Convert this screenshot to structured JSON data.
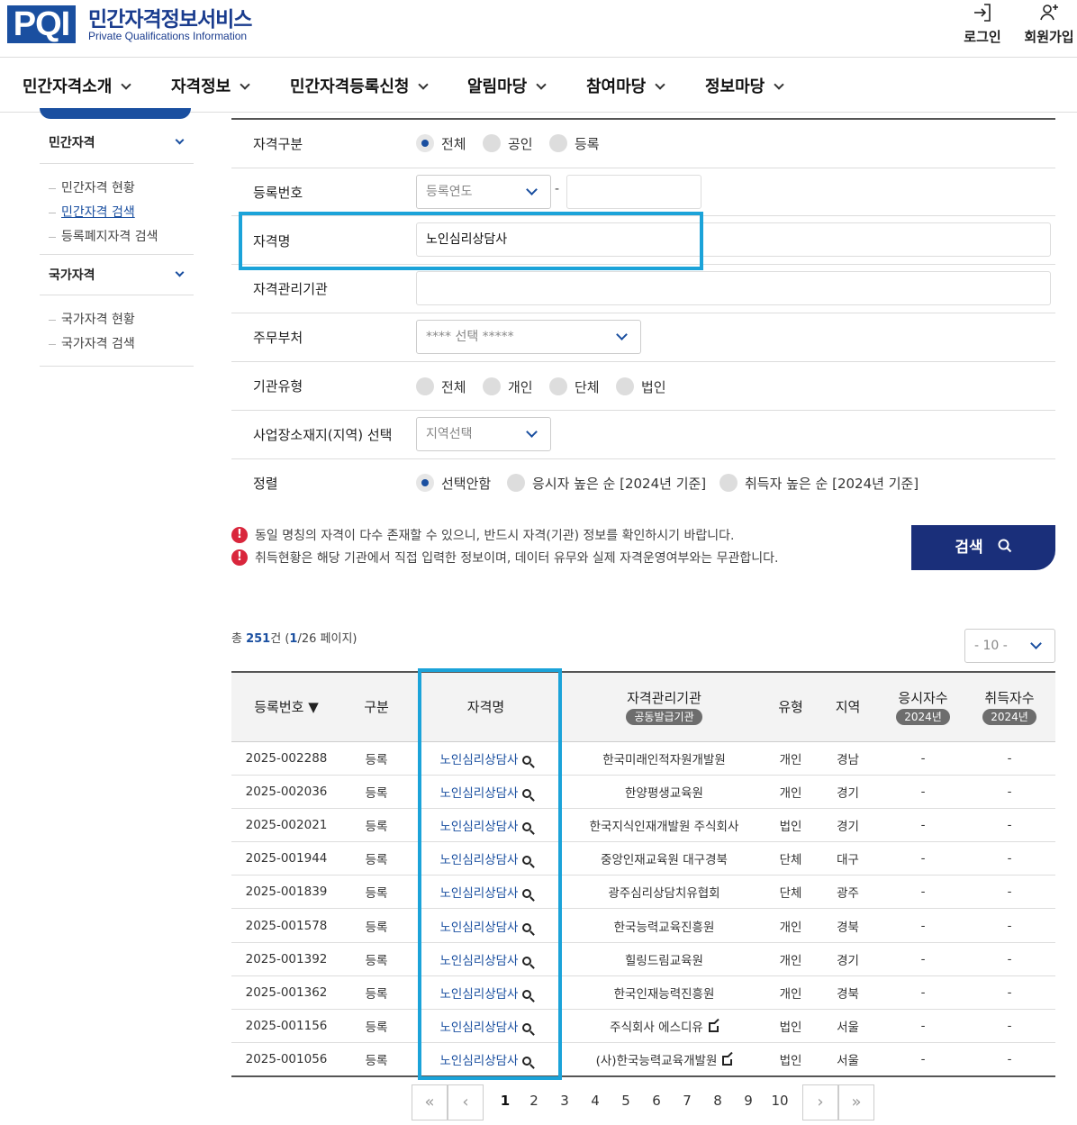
{
  "header": {
    "logo": "PQI",
    "title": "민간자격정보서비스",
    "subtitle": "Private Qualifications Information",
    "login_label": "로그인",
    "signup_label": "회원가입"
  },
  "nav": {
    "items": [
      "민간자격소개",
      "자격정보",
      "민간자격등록신청",
      "알림마당",
      "참여마당",
      "정보마당"
    ]
  },
  "sidebar": {
    "private_head": "민간자격",
    "private_links": [
      "민간자격 현황",
      "민간자격 검색",
      "등록폐지자격 검색"
    ],
    "national_head": "국가자격",
    "national_links": [
      "국가자격 현황",
      "국가자격 검색"
    ]
  },
  "form": {
    "category": {
      "label": "자격구분",
      "options": [
        "전체",
        "공인",
        "등록"
      ],
      "selected": "전체"
    },
    "reg_no": {
      "label": "등록번호",
      "year_placeholder": "등록연도",
      "sep": "-"
    },
    "name": {
      "label": "자격명",
      "value": "노인심리상담사"
    },
    "agency": {
      "label": "자격관리기관",
      "value": ""
    },
    "ministry": {
      "label": "주무부처",
      "placeholder": "**** 선택 *****"
    },
    "org_type": {
      "label": "기관유형",
      "options": [
        "전체",
        "개인",
        "단체",
        "법인"
      ]
    },
    "region": {
      "label": "사업장소재지(지역) 선택",
      "placeholder": "지역선택"
    },
    "sort": {
      "label": "정렬",
      "options": [
        "선택안함",
        "응시자 높은 순 [2024년 기준]",
        "취득자 높은 순 [2024년 기준]"
      ],
      "selected": "선택안함"
    }
  },
  "notices": [
    "동일 명칭의 자격이 다수 존재할 수 있으니, 반드시 자격(기관) 정보를 확인하시기 바랍니다.",
    "취득현황은 해당 기관에서 직접 입력한 정보이며, 데이터 유무와 실제 자격운영여부와는 무관합니다."
  ],
  "search_label": "검색",
  "results": {
    "prefix": "총 ",
    "total": "251",
    "unit": "건",
    "page_open": " (",
    "page": "1",
    "page_rest": "/26 페이지)",
    "per_page": "- 10 -"
  },
  "table": {
    "headers": {
      "reg_no": "등록번호 ▼",
      "category": "구분",
      "name": "자격명",
      "agency": "자격관리기관",
      "agency_pill": "공동발급기관",
      "type": "유형",
      "region": "지역",
      "applicants": "응시자수",
      "applicants_pill": "2024년",
      "acquirers": "취득자수",
      "acquirers_pill": "2024년"
    },
    "rows": [
      {
        "reg_no": "2025-002288",
        "category": "등록",
        "name": "노인심리상담사",
        "agency": "한국미래인적자원개발원",
        "ext": false,
        "type": "개인",
        "region": "경남",
        "applicants": "-",
        "acquirers": "-"
      },
      {
        "reg_no": "2025-002036",
        "category": "등록",
        "name": "노인심리상담사",
        "agency": "한양평생교육원",
        "ext": false,
        "type": "개인",
        "region": "경기",
        "applicants": "-",
        "acquirers": "-"
      },
      {
        "reg_no": "2025-002021",
        "category": "등록",
        "name": "노인심리상담사",
        "agency": "한국지식인재개발원 주식회사",
        "ext": false,
        "type": "법인",
        "region": "경기",
        "applicants": "-",
        "acquirers": "-"
      },
      {
        "reg_no": "2025-001944",
        "category": "등록",
        "name": "노인심리상담사",
        "agency": "중앙인재교육원 대구경북",
        "ext": false,
        "type": "단체",
        "region": "대구",
        "applicants": "-",
        "acquirers": "-"
      },
      {
        "reg_no": "2025-001839",
        "category": "등록",
        "name": "노인심리상담사",
        "agency": "광주심리상담치유협회",
        "ext": false,
        "type": "단체",
        "region": "광주",
        "applicants": "-",
        "acquirers": "-"
      },
      {
        "reg_no": "2025-001578",
        "category": "등록",
        "name": "노인심리상담사",
        "agency": "한국능력교육진흥원",
        "ext": false,
        "type": "개인",
        "region": "경북",
        "applicants": "-",
        "acquirers": "-"
      },
      {
        "reg_no": "2025-001392",
        "category": "등록",
        "name": "노인심리상담사",
        "agency": "힐링드림교육원",
        "ext": false,
        "type": "개인",
        "region": "경기",
        "applicants": "-",
        "acquirers": "-"
      },
      {
        "reg_no": "2025-001362",
        "category": "등록",
        "name": "노인심리상담사",
        "agency": "한국인재능력진흥원",
        "ext": false,
        "type": "개인",
        "region": "경북",
        "applicants": "-",
        "acquirers": "-"
      },
      {
        "reg_no": "2025-001156",
        "category": "등록",
        "name": "노인심리상담사",
        "agency": "주식회사 에스디유",
        "ext": true,
        "type": "법인",
        "region": "서울",
        "applicants": "-",
        "acquirers": "-"
      },
      {
        "reg_no": "2025-001056",
        "category": "등록",
        "name": "노인심리상담사",
        "agency": "(사)한국능력교육개발원",
        "ext": true,
        "type": "법인",
        "region": "서울",
        "applicants": "-",
        "acquirers": "-"
      }
    ]
  },
  "pagination": {
    "first": "«",
    "prev": "‹",
    "pages": [
      "1",
      "2",
      "3",
      "4",
      "5",
      "6",
      "7",
      "8",
      "9",
      "10"
    ],
    "current": "1",
    "next": "›",
    "last": "»"
  }
}
